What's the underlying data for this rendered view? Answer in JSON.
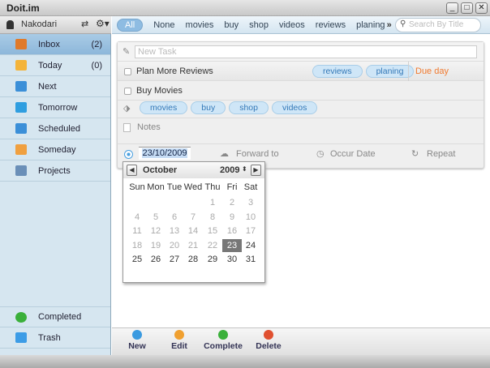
{
  "window": {
    "title": "Doit.im",
    "controls": [
      "_",
      "□",
      "✕"
    ]
  },
  "user": {
    "name": "Nakodari"
  },
  "sidebar": {
    "items": [
      {
        "label": "Inbox",
        "count": "(2)",
        "icon": "inbox-icon",
        "color": "#e07a2a"
      },
      {
        "label": "Today",
        "count": "(0)",
        "icon": "star-icon",
        "color": "#f4b43a"
      },
      {
        "label": "Next",
        "count": "",
        "icon": "next-icon",
        "color": "#3b8fd8"
      },
      {
        "label": "Tomorrow",
        "count": "",
        "icon": "tomorrow-icon",
        "color": "#2f9ee0"
      },
      {
        "label": "Scheduled",
        "count": "",
        "icon": "calendar-icon",
        "color": "#3b8fd8"
      },
      {
        "label": "Someday",
        "count": "",
        "icon": "someday-icon",
        "color": "#f0a040"
      },
      {
        "label": "Projects",
        "count": "",
        "icon": "projects-icon",
        "color": "#6a8fb8"
      }
    ],
    "bottom": [
      {
        "label": "Completed",
        "icon": "check-circle-icon",
        "color": "#3ab03a"
      },
      {
        "label": "Trash",
        "icon": "trash-icon",
        "color": "#3c9ce6"
      }
    ]
  },
  "filters": [
    "All",
    "None",
    "movies",
    "buy",
    "shop",
    "videos",
    "reviews",
    "planing"
  ],
  "filters_more": "»",
  "search": {
    "placeholder": "Search By Title"
  },
  "new_task": {
    "placeholder": "New Task"
  },
  "tasks": [
    {
      "title": "Plan More Reviews",
      "tags": [
        "reviews",
        "planing"
      ],
      "due": "Due day"
    },
    {
      "title": "Buy Movies",
      "tags": [
        "movies",
        "buy",
        "shop",
        "videos"
      ],
      "notes": "Notes",
      "date": "23/10/2009",
      "forward": "Forward to",
      "occur": "Occur Date",
      "repeat": "Repeat"
    }
  ],
  "calendar": {
    "month": "October",
    "year": "2009",
    "weekdays": [
      "Sun",
      "Mon",
      "Tue",
      "Wed",
      "Thu",
      "Fri",
      "Sat"
    ],
    "first_weekday": 4,
    "days": 31,
    "selected": 23
  },
  "toolbar": [
    {
      "label": "New",
      "color": "#3a9ae0"
    },
    {
      "label": "Edit",
      "color": "#f0a030"
    },
    {
      "label": "Complete",
      "color": "#3ab03a"
    },
    {
      "label": "Delete",
      "color": "#e05030"
    }
  ],
  "accent": "#8ebce2"
}
